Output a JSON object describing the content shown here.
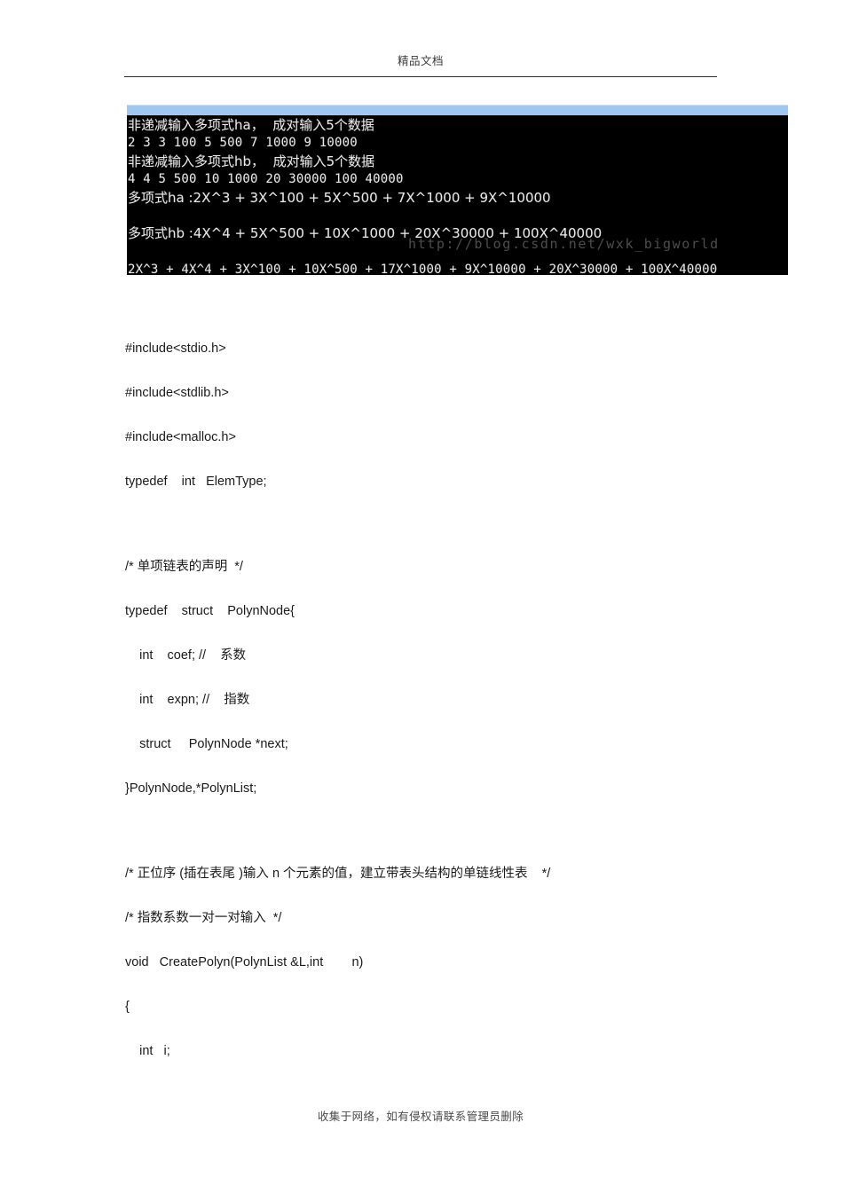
{
  "page": {
    "header_text": "精品文档",
    "footer_text": "收集于网络，如有侵权请联系管理员删除"
  },
  "console": {
    "watermark": "http://blog.csdn.net/wxk_bigworld",
    "lines": [
      {
        "text": "非递减输入多项式ha，  成对输入5个数据",
        "cjk": true
      },
      {
        "text": "2 3 3 100 5 500 7 1000 9 10000",
        "cjk": false
      },
      {
        "text": "非递减输入多项式hb，  成对输入5个数据",
        "cjk": true
      },
      {
        "text": "4 4 5 500 10 1000 20 30000 100 40000",
        "cjk": false
      },
      {
        "text": "多项式ha :2X^3 + 3X^100 + 5X^500 + 7X^1000 + 9X^10000",
        "cjk": true
      },
      {
        "text": "",
        "cjk": false
      },
      {
        "text": "多项式hb :4X^4 + 5X^500 + 10X^1000 + 20X^30000 + 100X^40000",
        "cjk": true
      },
      {
        "text": "",
        "cjk": false
      },
      {
        "text": "2X^3 + 4X^4 + 3X^100 + 10X^500 + 17X^1000 + 9X^10000 + 20X^30000 + 100X^40000",
        "cjk": false
      }
    ]
  },
  "code": {
    "lines": [
      "#include<stdio.h>",
      "#include<stdlib.h>",
      "#include<malloc.h>",
      "typedef    int   ElemType;",
      "/* 单项链表的声明  */",
      "typedef    struct    PolynNode{",
      "    int    coef; //    系数",
      "    int    expn; //    指数",
      "    struct     PolynNode *next;",
      "}PolynNode,*PolynList;",
      "/* 正位序 (插在表尾 )输入 n 个元素的值，建立带表头结构的单链线性表    */",
      "/* 指数系数一对一对输入  */",
      "void   CreatePolyn(PolynList &L,int        n)",
      "{",
      "    int   i;"
    ]
  }
}
